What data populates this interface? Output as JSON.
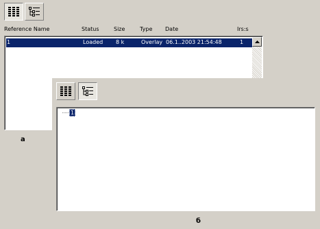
{
  "panel_a": {
    "toolbar": {
      "list_view_icon": "list-view-icon",
      "tree_view_icon": "tree-view-icon"
    },
    "columns": [
      "Reference Name",
      "Status",
      "Size",
      "Type",
      "Date",
      "Irs:s"
    ],
    "rows": [
      {
        "name": "1",
        "status": "Loaded",
        "size": "8 k",
        "type": "Overlay",
        "date": "06.1..2003 21:54:48",
        "irss": "1",
        "selected": true
      }
    ],
    "label": "a"
  },
  "panel_b": {
    "toolbar": {
      "list_view_icon": "list-view-icon",
      "tree_view_icon": "tree-view-icon",
      "active": "tree-view"
    },
    "tree": [
      {
        "label": "1",
        "selected": true
      }
    ],
    "label": "б"
  },
  "colors": {
    "face": "#d4d0c8",
    "selection": "#0a246a",
    "selection_text": "#ffffff"
  }
}
